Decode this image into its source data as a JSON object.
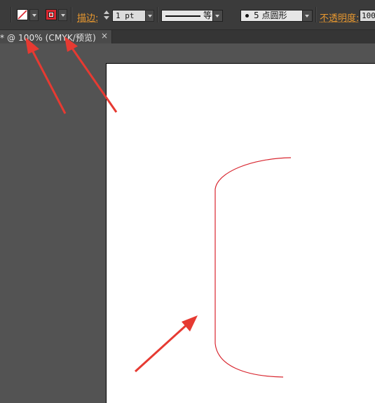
{
  "control_bar": {
    "fill_swatch": {
      "icon": "none-fill-swatch-icon",
      "color": "#ffffff",
      "slash_color": "#d8262f"
    },
    "stroke_swatch": {
      "icon": "stroke-swatch-icon",
      "color": "#d8262f"
    },
    "stroke_label": "描边:",
    "stroke_weight": "1 pt",
    "profile_label": "等比",
    "brush_label": "5 点圆形",
    "opacity_label": "不透明度:",
    "opacity_value": "100"
  },
  "document_tab": {
    "title": "* @ 100% (CMYK/预览)",
    "close": "×"
  },
  "colors": {
    "accent_orange": "#e8982f",
    "annotation_red": "#e63a32",
    "path_red": "#d8262f",
    "artboard": "#ffffff",
    "pasteboard": "#535353"
  }
}
